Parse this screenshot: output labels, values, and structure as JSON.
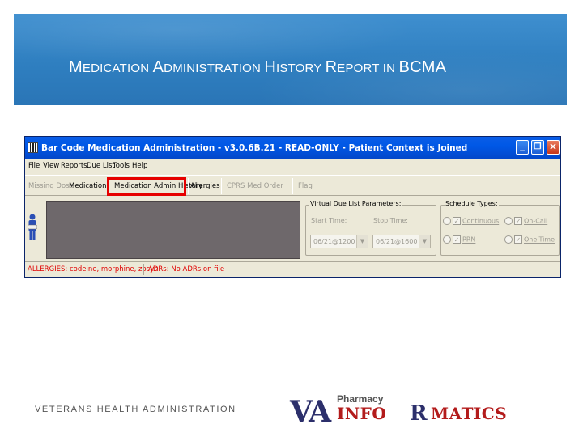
{
  "slide": {
    "title_parts": [
      {
        "big": "M",
        "small": "EDICATION "
      },
      {
        "big": "A",
        "small": "DMINISTRATION "
      },
      {
        "big": "H",
        "small": "ISTORY "
      },
      {
        "big": "R",
        "small": "EPORT IN "
      },
      {
        "big": "BCMA",
        "small": ""
      }
    ],
    "footer": "VETERANS HEALTH ADMINISTRATION",
    "logo": {
      "va": "VA",
      "pharmacy": "Pharmacy",
      "info": "INFO",
      "rx": "R",
      "matics": "MATICS"
    },
    "colors": {
      "header_blue": "#2f7fc0",
      "highlight_red": "#e60000",
      "allergy_red": "#e00000"
    }
  },
  "window": {
    "title": "Bar Code Medication Administration - v3.0.6B.21 - READ-ONLY -  Patient Context is Joined",
    "min_label": "_",
    "max_label": "❐",
    "close_label": "✕"
  },
  "menu": [
    "File",
    "View",
    "Reports",
    "Due List",
    "Tools",
    "Help"
  ],
  "toolbar": {
    "missing_dose": "Missing Dose",
    "medication_log": "Medication Log",
    "medication_admin_history": "Medication Admin History",
    "allergies": "Allergies",
    "cprs_med_order": "CPRS Med Order",
    "flag": "Flag"
  },
  "due_list": {
    "group_label": "Virtual Due List Parameters:",
    "start_label": "Start Time:",
    "stop_label": "Stop Time:",
    "start_value": "06/21@1200",
    "stop_value": "06/21@1600"
  },
  "schedule": {
    "group_label": "Schedule Types:",
    "continuous": "Continuous",
    "prn": "PRN",
    "on_call": "On-Call",
    "one_time": "One-Time"
  },
  "allergy_bar": {
    "allergies": "ALLERGIES: codeine, morphine, zosyn",
    "adrs": "ADRs: No ADRs on file"
  }
}
